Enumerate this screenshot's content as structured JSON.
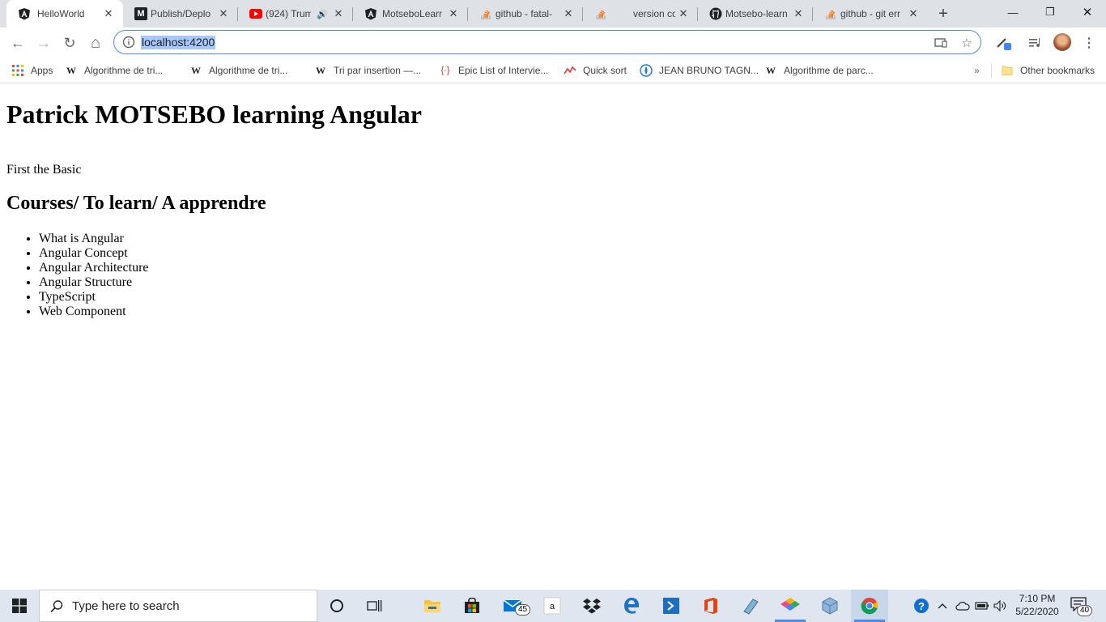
{
  "browser": {
    "tabs": [
      {
        "title": "HelloWorld",
        "icon": "angular-icon",
        "active": true
      },
      {
        "title": "Publish/Deplo",
        "icon": "medium-icon"
      },
      {
        "title": "(924) Trum",
        "icon": "youtube-icon",
        "audio": true
      },
      {
        "title": "MotseboLearni",
        "icon": "angular-icon"
      },
      {
        "title": "github - fatal-",
        "icon": "stackoverflow-icon"
      },
      {
        "title": "version contro",
        "icon": "stackoverflow-icon"
      },
      {
        "title": "Motsebo-learn",
        "icon": "github-icon"
      },
      {
        "title": "github - git err",
        "icon": "stackoverflow-icon"
      }
    ],
    "new_tab_label": "+",
    "window_controls": {
      "minimize": "—",
      "restore": "❐",
      "close": "✕"
    }
  },
  "toolbar": {
    "back": "←",
    "forward": "→",
    "reload": "↻",
    "home": "⌂",
    "url": "localhost:4200"
  },
  "bookmarks": {
    "apps_label": "Apps",
    "items": [
      {
        "label": "Algorithme de tri...",
        "icon": "wikipedia-icon"
      },
      {
        "label": "Algorithme de tri...",
        "icon": "wikipedia-icon"
      },
      {
        "label": "Tri par insertion —...",
        "icon": "wikipedia-icon"
      },
      {
        "label": "Epic List of Intervie...",
        "icon": "code-icon"
      },
      {
        "label": "Quick sort",
        "icon": "quicksort-icon"
      },
      {
        "label": "JEAN BRUNO TAGN...",
        "icon": "globe-icon"
      },
      {
        "label": "Algorithme de parc...",
        "icon": "wikipedia-icon"
      }
    ],
    "more": "»",
    "other_bookmarks": "Other bookmarks"
  },
  "page": {
    "heading": "Patrick MOTSEBO learning Angular",
    "intro": "First the Basic",
    "courses_heading": "Courses/ To learn/ A apprendre",
    "courses": [
      "What is Angular",
      "Angular Concept",
      "Angular Architecture",
      "Angular Structure",
      "TypeScript",
      "Web Component"
    ]
  },
  "taskbar": {
    "search_placeholder": "Type here to search",
    "mail_badge": "45",
    "time": "7:10 PM",
    "date": "5/22/2020",
    "notification_count": "40"
  },
  "colors": {
    "tab_strip": "#dee1e6",
    "omnibox_border": "#4c8bf5",
    "url_selection": "#a8c7fa",
    "taskbar": "#dfe6ef"
  }
}
